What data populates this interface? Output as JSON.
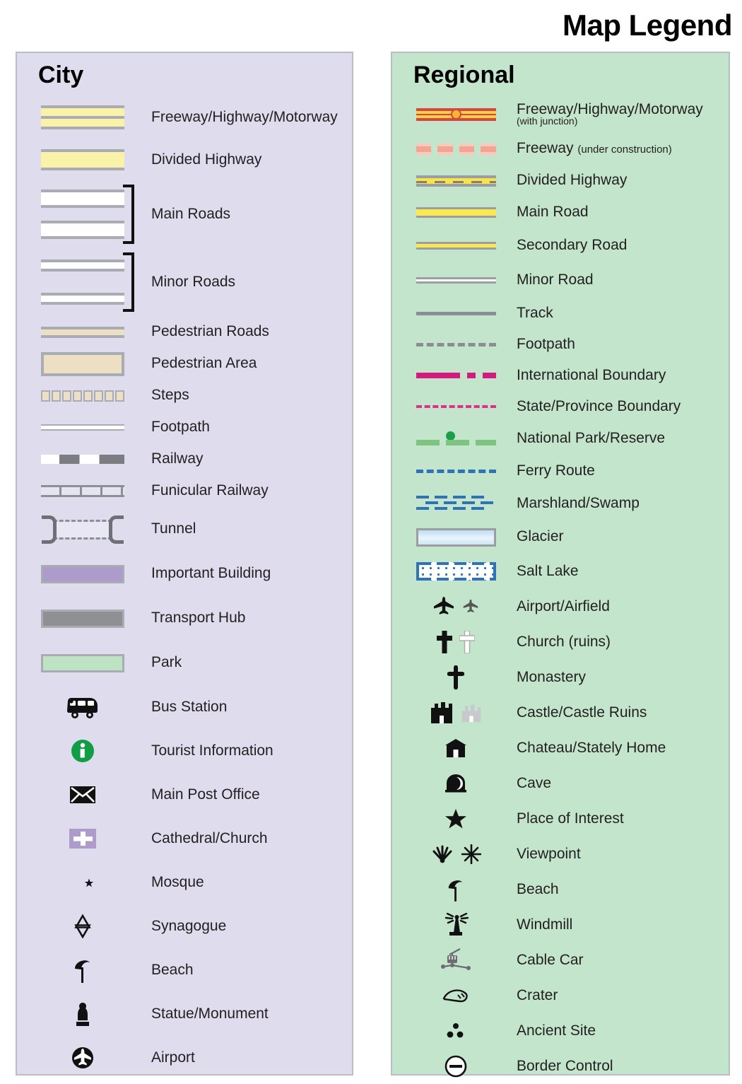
{
  "title": "Map Legend",
  "colors": {
    "city_panel_bg": "#dedced",
    "regional_panel_bg": "#c3e5cb",
    "panel_border": "#b9bdc4",
    "road_yellow": "#f9f2a8",
    "regional_yellow": "#fbe94f",
    "freeway_red": "#d9453f",
    "junction_orange": "#f7b733",
    "pedestrian_tan": "#ecdfc4",
    "important_building_purple": "#ad9ccb",
    "transport_hub_gray": "#8e9094",
    "park_green": "#bde3c4",
    "boundary_magenta": "#d6197f",
    "national_park_green": "#7cc47f",
    "ferry_blue": "#2f72b8",
    "tourist_info_green": "#0f9d46",
    "casing_gray": "#a9acb3"
  },
  "city": {
    "heading": "City",
    "items": [
      {
        "label": "Freeway/Highway/Motorway",
        "symbol": "freeway-swatch"
      },
      {
        "label": "Divided Highway",
        "symbol": "divided-highway-swatch"
      },
      {
        "label": "Main Roads",
        "symbol": "main-roads-swatch"
      },
      {
        "label": "Minor Roads",
        "symbol": "minor-roads-swatch"
      },
      {
        "label": "Pedestrian Roads",
        "symbol": "pedestrian-road-swatch"
      },
      {
        "label": "Pedestrian Area",
        "symbol": "pedestrian-area-swatch"
      },
      {
        "label": "Steps",
        "symbol": "steps-swatch"
      },
      {
        "label": "Footpath",
        "symbol": "footpath-swatch"
      },
      {
        "label": "Railway",
        "symbol": "railway-swatch"
      },
      {
        "label": "Funicular Railway",
        "symbol": "funicular-railway-swatch"
      },
      {
        "label": "Tunnel",
        "symbol": "tunnel-swatch"
      },
      {
        "label": "Important Building",
        "symbol": "important-building-swatch"
      },
      {
        "label": "Transport Hub",
        "symbol": "transport-hub-swatch"
      },
      {
        "label": "Park",
        "symbol": "park-swatch"
      },
      {
        "label": "Bus Station",
        "symbol": "bus-icon"
      },
      {
        "label": "Tourist Information",
        "symbol": "information-icon"
      },
      {
        "label": "Main Post Office",
        "symbol": "envelope-icon"
      },
      {
        "label": "Cathedral/Church",
        "symbol": "church-cross-icon"
      },
      {
        "label": "Mosque",
        "symbol": "star-and-crescent-icon"
      },
      {
        "label": "Synagogue",
        "symbol": "star-of-david-icon"
      },
      {
        "label": "Beach",
        "symbol": "beach-umbrella-icon"
      },
      {
        "label": "Statue/Monument",
        "symbol": "statue-icon"
      },
      {
        "label": "Airport",
        "symbol": "airport-icon"
      }
    ]
  },
  "regional": {
    "heading": "Regional",
    "items": [
      {
        "label": "Freeway/Highway/Motorway",
        "sublabel": "(with junction)",
        "symbol": "regional-freeway-swatch"
      },
      {
        "label": "Freeway",
        "inline_note": "(under construction)",
        "symbol": "freeway-under-construction-swatch"
      },
      {
        "label": "Divided Highway",
        "symbol": "regional-divided-highway-swatch"
      },
      {
        "label": "Main Road",
        "symbol": "regional-main-road-swatch"
      },
      {
        "label": "Secondary Road",
        "symbol": "secondary-road-swatch"
      },
      {
        "label": "Minor Road",
        "symbol": "regional-minor-road-swatch"
      },
      {
        "label": "Track",
        "symbol": "track-swatch"
      },
      {
        "label": "Footpath",
        "symbol": "regional-footpath-swatch"
      },
      {
        "label": "International Boundary",
        "symbol": "international-boundary-swatch"
      },
      {
        "label": "State/Province Boundary",
        "symbol": "state-boundary-swatch"
      },
      {
        "label": "National Park/Reserve",
        "symbol": "national-park-swatch"
      },
      {
        "label": "Ferry Route",
        "symbol": "ferry-route-swatch"
      },
      {
        "label": "Marshland/Swamp",
        "symbol": "marshland-swatch"
      },
      {
        "label": "Glacier",
        "symbol": "glacier-swatch"
      },
      {
        "label": "Salt Lake",
        "symbol": "salt-lake-swatch"
      },
      {
        "label": "Airport/Airfield",
        "symbol": "airplane-icon"
      },
      {
        "label": "Church (ruins)",
        "symbol": "cross-icon"
      },
      {
        "label": "Monastery",
        "symbol": "monastery-cross-icon"
      },
      {
        "label": "Castle/Castle Ruins",
        "symbol": "castle-icon"
      },
      {
        "label": "Chateau/Stately Home",
        "symbol": "chateau-icon"
      },
      {
        "label": "Cave",
        "symbol": "cave-icon"
      },
      {
        "label": "Place of Interest",
        "symbol": "star-icon"
      },
      {
        "label": "Viewpoint",
        "symbol": "viewpoint-icon"
      },
      {
        "label": "Beach",
        "symbol": "beach-umbrella-icon"
      },
      {
        "label": "Windmill",
        "symbol": "windmill-icon"
      },
      {
        "label": "Cable Car",
        "symbol": "cable-car-icon"
      },
      {
        "label": "Crater",
        "symbol": "crater-icon"
      },
      {
        "label": "Ancient Site",
        "symbol": "ancient-site-icon"
      },
      {
        "label": "Border Control",
        "symbol": "border-control-icon"
      }
    ]
  }
}
